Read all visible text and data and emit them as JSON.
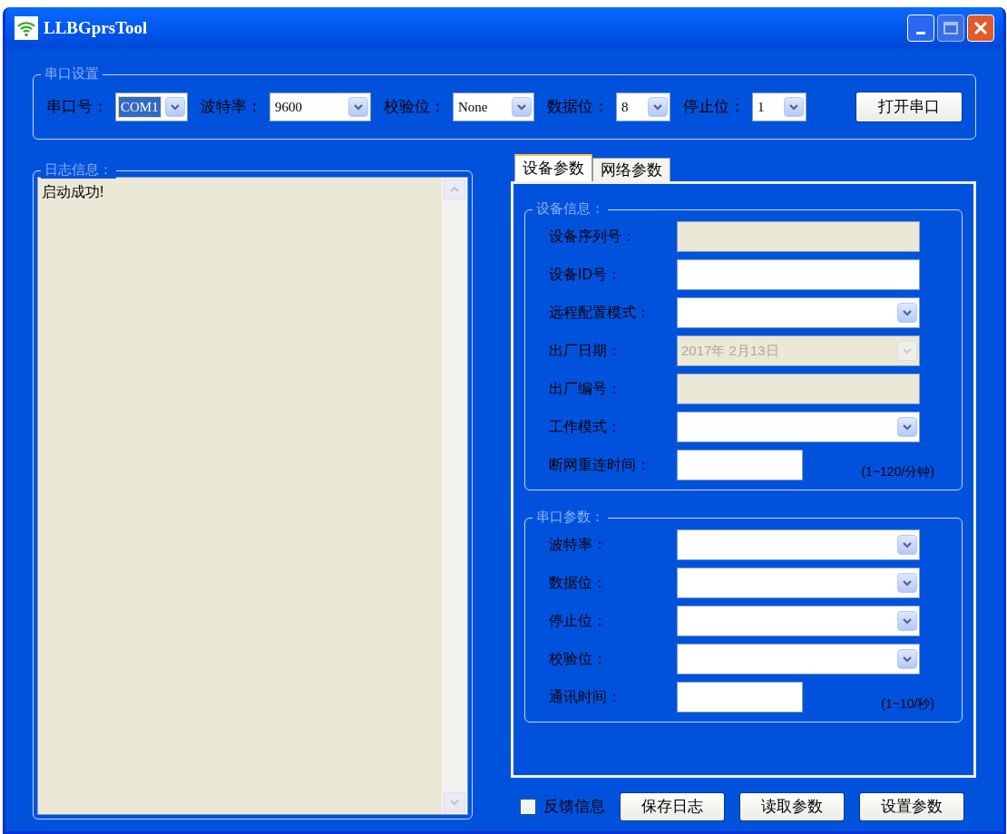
{
  "window": {
    "title": "LLBGprsTool"
  },
  "serial_settings": {
    "title": "串口设置",
    "fields": [
      {
        "label": "串口号：",
        "value": "COM1",
        "focused": true
      },
      {
        "label": "波特率：",
        "value": "9600",
        "focused": false
      },
      {
        "label": "校验位：",
        "value": "None",
        "focused": false
      },
      {
        "label": "数据位：",
        "value": "8",
        "focused": false
      },
      {
        "label": "停止位：",
        "value": "1",
        "focused": false
      }
    ],
    "button": "打开串口"
  },
  "log": {
    "title": "日志信息：",
    "text": "启动成功!"
  },
  "tabs": [
    {
      "label": "设备参数",
      "selected": true
    },
    {
      "label": "网络参数",
      "selected": false
    }
  ],
  "groups": [
    {
      "title": "设备信息：",
      "rows": [
        {
          "label": "设备序列号：",
          "kind": "text",
          "disabled": true
        },
        {
          "label": "设备ID号：",
          "kind": "text",
          "disabled": false
        },
        {
          "label": "远程配置模式：",
          "kind": "select",
          "disabled": false
        },
        {
          "label": "出厂日期：",
          "kind": "select",
          "disabled": true,
          "value": "2017年  2月13日"
        },
        {
          "label": "出厂编号：",
          "kind": "text",
          "disabled": true
        },
        {
          "label": "工作模式：",
          "kind": "select",
          "disabled": false
        },
        {
          "label": "断网重连时间：",
          "kind": "short",
          "disabled": false,
          "note": "(1~120/分钟)"
        }
      ]
    },
    {
      "title": "串口参数：",
      "rows": [
        {
          "label": "波特率：",
          "kind": "select",
          "disabled": false
        },
        {
          "label": "数据位：",
          "kind": "select",
          "disabled": false
        },
        {
          "label": "停止位：",
          "kind": "select",
          "disabled": false
        },
        {
          "label": "校验位：",
          "kind": "select",
          "disabled": false
        },
        {
          "label": "通讯时间：",
          "kind": "short",
          "disabled": false,
          "note": "(1~10/秒)"
        }
      ]
    }
  ],
  "feedback": {
    "label": "反馈信息",
    "checked": false
  },
  "buttons": [
    "保存日志",
    "读取参数",
    "设置参数"
  ]
}
